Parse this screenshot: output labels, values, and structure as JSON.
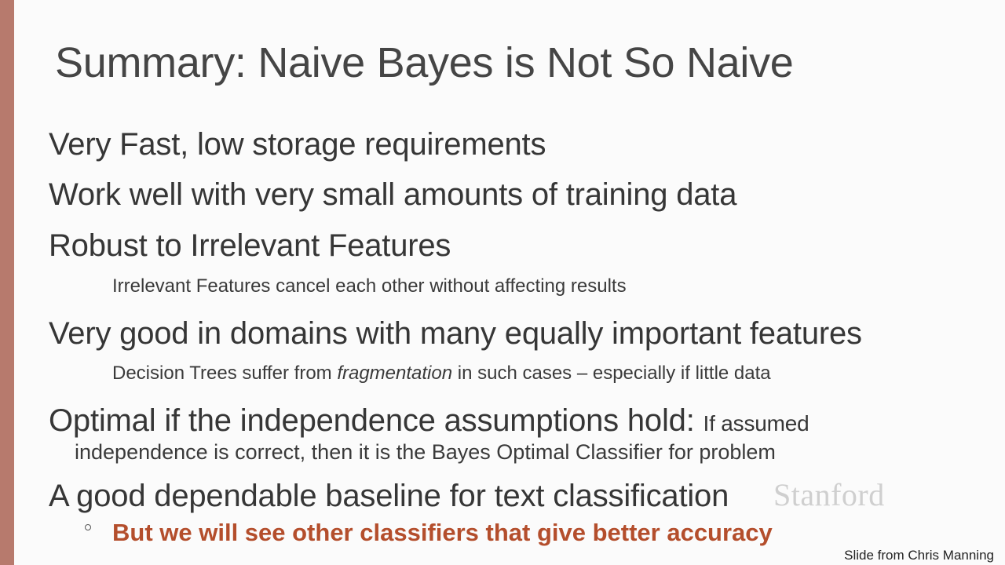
{
  "slide": {
    "title": "Summary: Naive Bayes is Not So Naive",
    "bullets": [
      {
        "text": "Very Fast, low storage requirements"
      },
      {
        "text": "Work well with very small amounts of training data"
      },
      {
        "text": "Robust to Irrelevant Features"
      },
      {
        "text": "Very good in domains with many equally important features"
      },
      {
        "text": "Optimal if the independence assumptions hold: "
      },
      {
        "text": "A good dependable baseline for text classification"
      }
    ],
    "sub_irrelevant": "Irrelevant Features cancel each other without affecting results",
    "sub_fragmentation": {
      "before": "Decision Trees suffer from ",
      "emph": "fragmentation",
      "after": " in such cases – especially if little data"
    },
    "optimal_inline": "If assumed",
    "optimal_continuation": "independence is correct, then it is the Bayes Optimal Classifier for problem",
    "red_sub": "But we will see other classifiers that give better accuracy",
    "watermark": "Stanford",
    "credit": "Slide from Chris Manning"
  },
  "colors": {
    "left_bar": "#b77a6d",
    "accent_red": "#b44e2c",
    "background": "#fbfbfb"
  }
}
